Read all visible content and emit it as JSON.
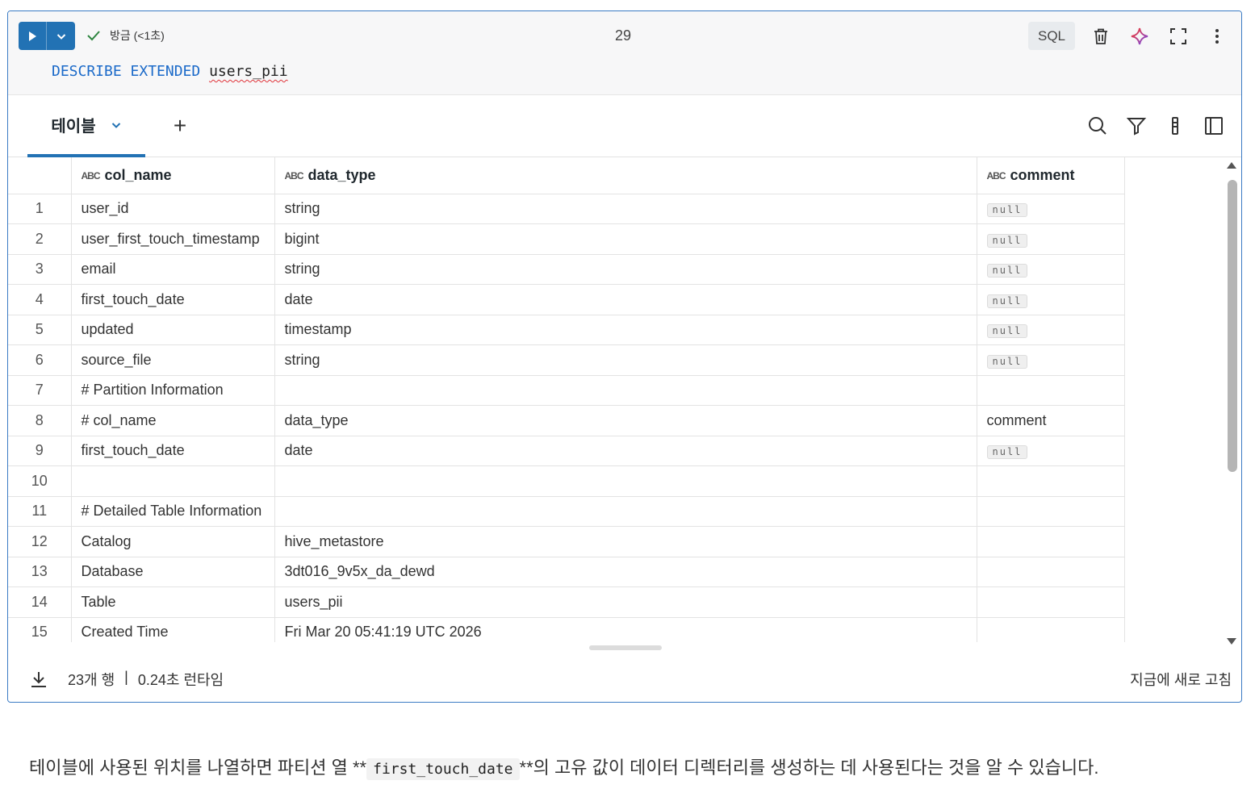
{
  "cell": {
    "status": "방금 (<1초)",
    "cell_number": "29",
    "language": "SQL",
    "code_keywords": "DESCRIBE EXTENDED",
    "code_identifier": "users_pii"
  },
  "results": {
    "tab_label": "테이블",
    "add_tab": "+",
    "columns": [
      {
        "name": "col_name",
        "type_icon": "string-type-icon"
      },
      {
        "name": "data_type",
        "type_icon": "string-type-icon"
      },
      {
        "name": "comment",
        "type_icon": "string-type-icon"
      }
    ],
    "type_glyph": "ABC",
    "null_text": "null",
    "rows": [
      {
        "n": "1",
        "col_name": "user_id",
        "data_type": "string",
        "comment": "null"
      },
      {
        "n": "2",
        "col_name": "user_first_touch_timestamp",
        "data_type": "bigint",
        "comment": "null"
      },
      {
        "n": "3",
        "col_name": "email",
        "data_type": "string",
        "comment": "null"
      },
      {
        "n": "4",
        "col_name": "first_touch_date",
        "data_type": "date",
        "comment": "null"
      },
      {
        "n": "5",
        "col_name": "updated",
        "data_type": "timestamp",
        "comment": "null"
      },
      {
        "n": "6",
        "col_name": "source_file",
        "data_type": "string",
        "comment": "null"
      },
      {
        "n": "7",
        "col_name": "# Partition Information",
        "data_type": "",
        "comment": ""
      },
      {
        "n": "8",
        "col_name": "# col_name",
        "data_type": "data_type",
        "comment": "comment"
      },
      {
        "n": "9",
        "col_name": "first_touch_date",
        "data_type": "date",
        "comment": "null"
      },
      {
        "n": "10",
        "col_name": "",
        "data_type": "",
        "comment": ""
      },
      {
        "n": "11",
        "col_name": "# Detailed Table Information",
        "data_type": "",
        "comment": ""
      },
      {
        "n": "12",
        "col_name": "Catalog",
        "data_type": "hive_metastore",
        "comment": ""
      },
      {
        "n": "13",
        "col_name": "Database",
        "data_type": "3dt016_9v5x_da_dewd",
        "comment": ""
      },
      {
        "n": "14",
        "col_name": "Table",
        "data_type": "users_pii",
        "comment": ""
      },
      {
        "n": "15",
        "col_name": "Created Time",
        "data_type": "Fri Mar 20 05:41:19 UTC 2026",
        "comment": ""
      }
    ],
    "footer": {
      "row_count": "23개 행",
      "separator": "|",
      "runtime": "0.24초 런타임",
      "refreshed": "지금에 새로 고침"
    }
  },
  "caption": {
    "before": "테이블에 사용된 위치를 나열하면 파티션 열 **",
    "code": "first_touch_date",
    "after": "**의 고유 값이 데이터 디렉터리를 생성하는 데 사용된다는 것을 알 수 있습니다."
  },
  "colors": {
    "accent": "#2272b4",
    "check": "#2e8540",
    "keyword": "#1b6ac9",
    "squiggle": "#e0343a",
    "assistant_gradient": [
      "#ff3621",
      "#6e4ef2"
    ]
  }
}
